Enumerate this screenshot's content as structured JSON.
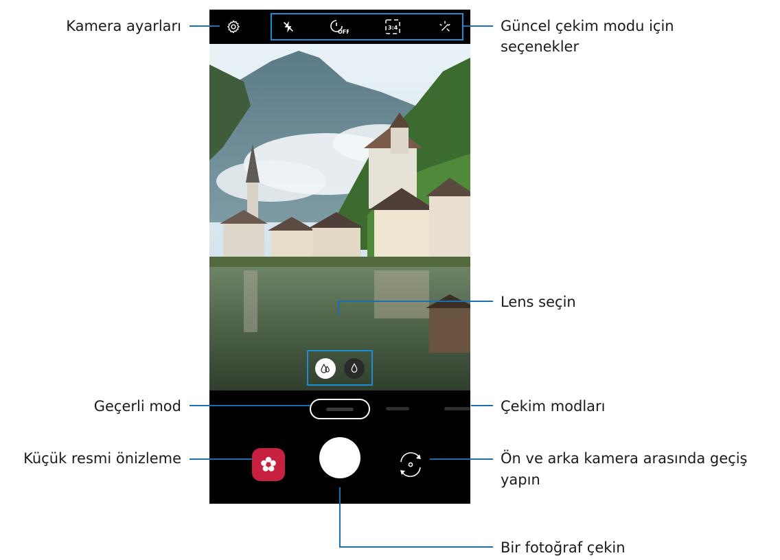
{
  "labels": {
    "camera_settings": "Kamera ayarları",
    "options_line1": "Güncel çekim modu için",
    "options_line2": "seçenekler",
    "select_lens": "Lens seçin",
    "current_mode": "Geçerli mod",
    "shooting_modes": "Çekim modları",
    "thumbnail_preview": "Küçük resmi önizleme",
    "switch_camera_line1": "Ön ve arka kamera arasında geçiş",
    "switch_camera_line2": "yapın",
    "take_photo": "Bir fotoğraf çekin"
  },
  "icons": {
    "settings": "gear-icon",
    "flash": "flash-off-icon",
    "timer": "timer-off-icon",
    "ratio": "aspect-ratio-icon",
    "filter": "effects-icon",
    "lens_wide": "wide-lens-icon",
    "lens_standard": "standard-lens-icon",
    "gallery": "gallery-thumbnail-icon",
    "switch": "switch-camera-icon"
  },
  "colors": {
    "callout_line": "#1a6fb0",
    "highlight_box": "#1a8fd8",
    "gallery_bg": "#c8213f"
  }
}
